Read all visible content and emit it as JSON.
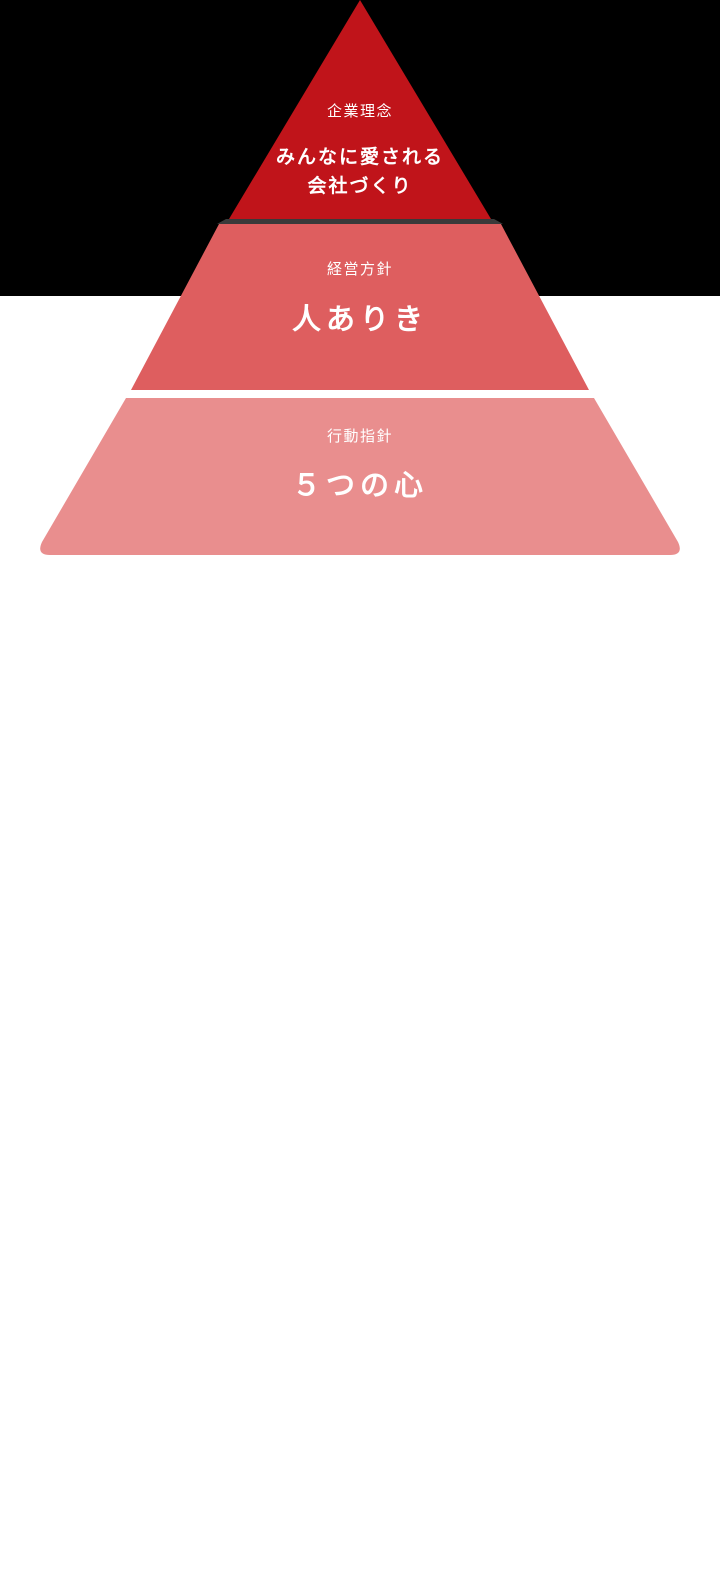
{
  "colors": {
    "top_band": "#000000",
    "background": "#ffffff",
    "tier_1": "#c0141a",
    "tier_2": "#de5e5f",
    "tier_3": "#e98e8e",
    "text": "#ffffff"
  },
  "pyramid": {
    "tiers": [
      {
        "label": "企業理念",
        "title": "みんなに愛される会社づくり"
      },
      {
        "label": "経営方針",
        "title": "人ありき"
      },
      {
        "label": "行動指針",
        "title": "５つの心"
      }
    ]
  }
}
